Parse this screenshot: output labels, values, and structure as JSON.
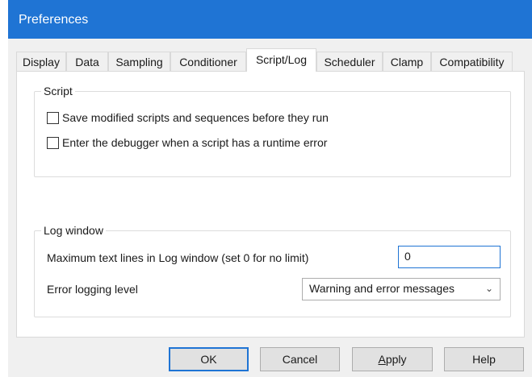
{
  "window": {
    "title": "Preferences"
  },
  "tabs": [
    {
      "label": "Display"
    },
    {
      "label": "Data"
    },
    {
      "label": "Sampling"
    },
    {
      "label": "Conditioner"
    },
    {
      "label": "Script/Log",
      "active": true
    },
    {
      "label": "Scheduler"
    },
    {
      "label": "Clamp"
    },
    {
      "label": "Compatibility"
    }
  ],
  "script_group": {
    "legend": "Script",
    "options": [
      {
        "label": "Save modified scripts and sequences before they run",
        "checked": false
      },
      {
        "label": "Enter the debugger when a script has a runtime error",
        "checked": false
      }
    ]
  },
  "log_group": {
    "legend": "Log window",
    "max_lines_label": "Maximum text lines in Log window (set 0 for no limit)",
    "max_lines_value": "0",
    "error_level_label": "Error logging level",
    "error_level_value": "Warning and error messages"
  },
  "buttons": {
    "ok": "OK",
    "cancel": "Cancel",
    "apply_prefix": "A",
    "apply_rest": "pply",
    "help": "Help"
  }
}
